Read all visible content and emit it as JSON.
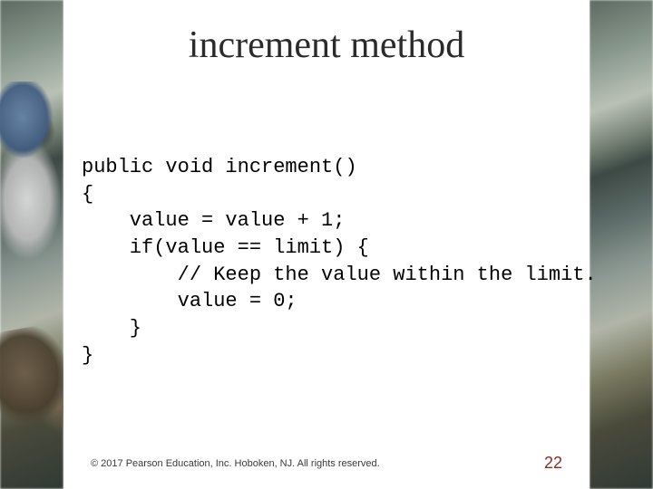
{
  "title": "increment method",
  "code_lines": [
    "public void increment()",
    "{",
    "    value = value + 1;",
    "    if(value == limit) {",
    "        // Keep the value within the limit.",
    "        value = 0;",
    "    }",
    "}"
  ],
  "copyright": "© 2017 Pearson Education, Inc. Hoboken, NJ. All rights reserved.",
  "page_number": "22"
}
